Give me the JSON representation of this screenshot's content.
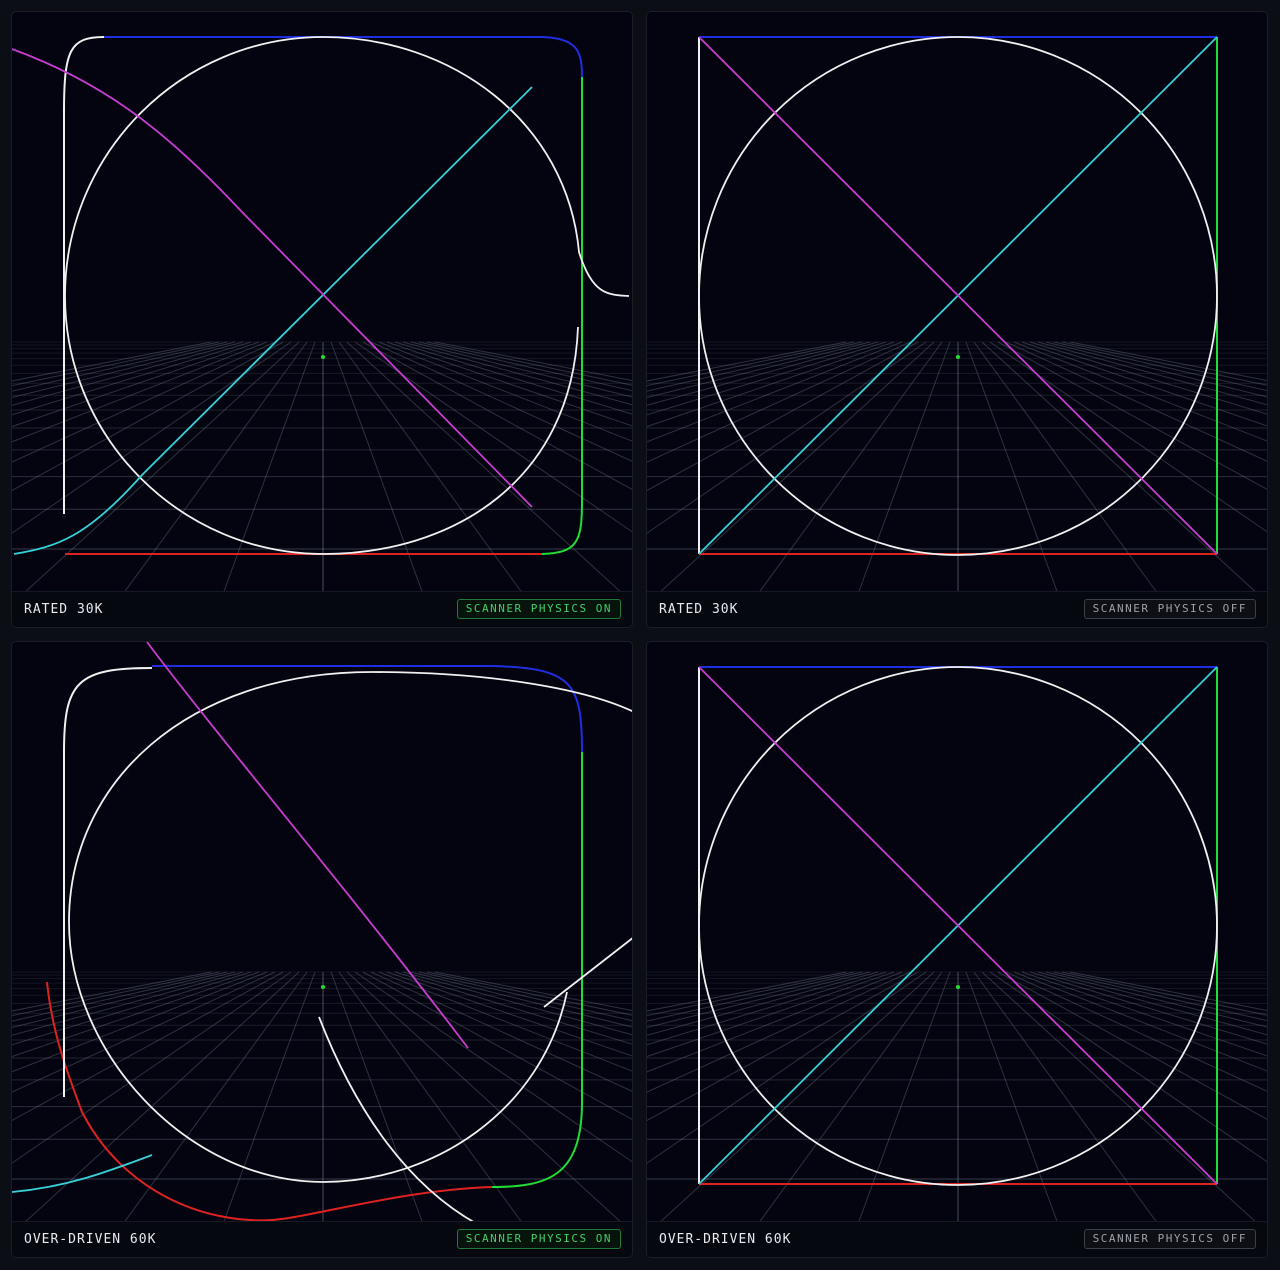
{
  "panels": [
    {
      "label": "RATED 30K",
      "badge": "SCANNER PHYSICS ON",
      "physics": true
    },
    {
      "label": "RATED 30K",
      "badge": "SCANNER PHYSICS OFF",
      "physics": false
    },
    {
      "label": "OVER-DRIVEN 60K",
      "badge": "SCANNER PHYSICS ON",
      "physics": true
    },
    {
      "label": "OVER-DRIVEN 60K",
      "badge": "SCANNER PHYSICS OFF",
      "physics": false
    }
  ],
  "colors": {
    "top_edge": "#1f2ee0",
    "right_edge": "#22dd33",
    "bottom_edge": "#dd2222",
    "left_edge": "#f0f0f0",
    "circle": "#f0f0f0",
    "diag_main": "#38d0d8",
    "diag_anti": "#c83cd0",
    "grid": "#8088a0",
    "center_dot": "#22dd33"
  },
  "icons": [
    "center-dot-icon"
  ]
}
